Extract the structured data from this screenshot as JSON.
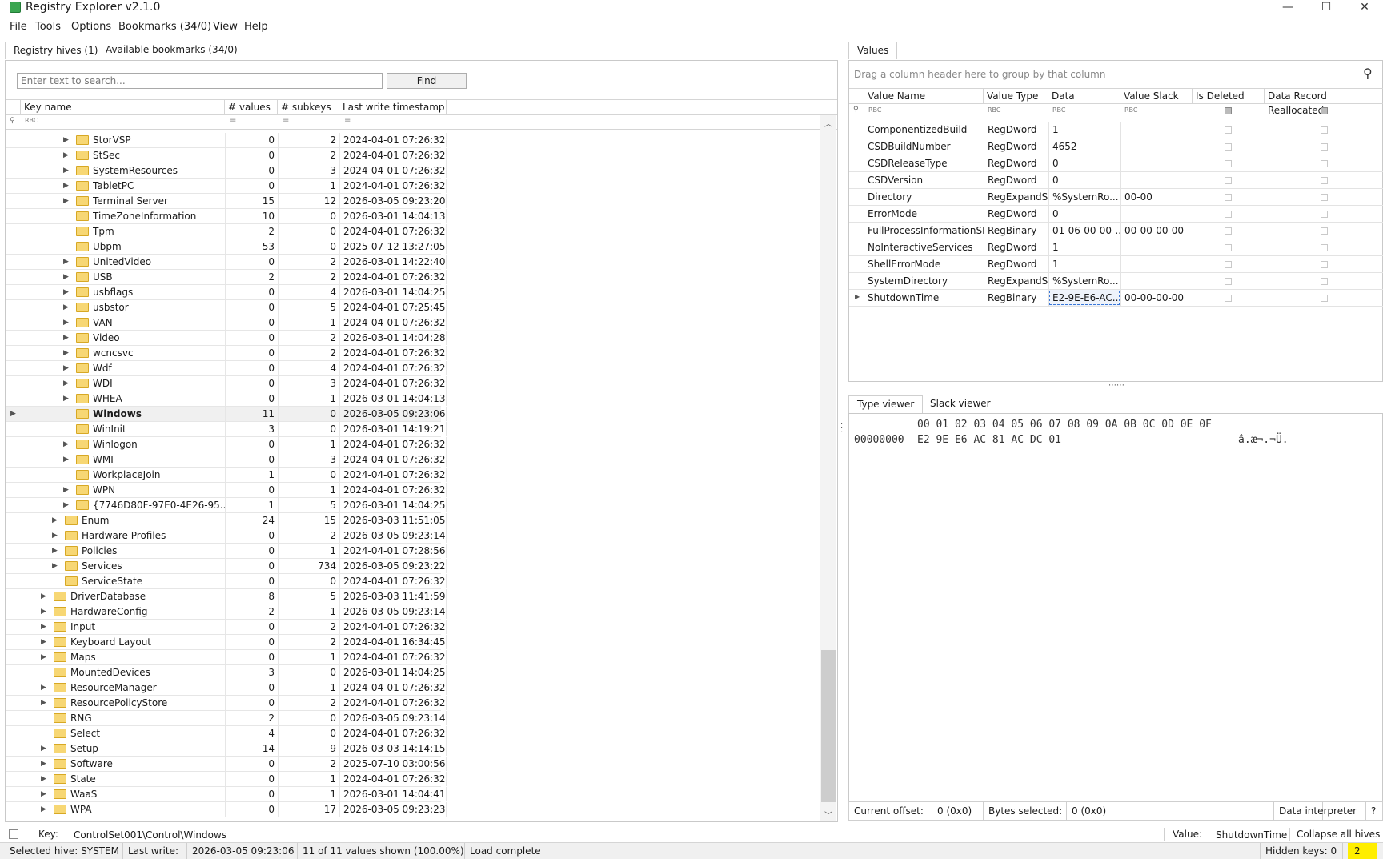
{
  "window": {
    "title": "Registry Explorer v2.1.0",
    "minimize": "—",
    "maximize": "☐",
    "close": "✕"
  },
  "menu": [
    "File",
    "Tools",
    "Options",
    "Bookmarks (34/0)",
    "View",
    "Help"
  ],
  "left_tabs": [
    "Registry hives (1)",
    "Available bookmarks (34/0)"
  ],
  "search": {
    "placeholder": "Enter text to search...",
    "find_label": "Find"
  },
  "tree_headers": [
    "Key name",
    "# values",
    "# subkeys",
    "Last write timestamp"
  ],
  "tree_filter": {
    "text_icon": "RBC",
    "eq": "="
  },
  "tree_rows": [
    {
      "name": "StorVSP",
      "indent": 4,
      "exp": true,
      "values": "0",
      "subkeys": "2",
      "ts": "2024-04-01 07:26:32"
    },
    {
      "name": "StSec",
      "indent": 4,
      "exp": true,
      "values": "0",
      "subkeys": "2",
      "ts": "2024-04-01 07:26:32"
    },
    {
      "name": "SystemResources",
      "indent": 4,
      "exp": true,
      "values": "0",
      "subkeys": "3",
      "ts": "2024-04-01 07:26:32"
    },
    {
      "name": "TabletPC",
      "indent": 4,
      "exp": true,
      "values": "0",
      "subkeys": "1",
      "ts": "2024-04-01 07:26:32"
    },
    {
      "name": "Terminal Server",
      "indent": 4,
      "exp": true,
      "values": "15",
      "subkeys": "12",
      "ts": "2026-03-05 09:23:20"
    },
    {
      "name": "TimeZoneInformation",
      "indent": 4,
      "exp": false,
      "values": "10",
      "subkeys": "0",
      "ts": "2026-03-01 14:04:13"
    },
    {
      "name": "Tpm",
      "indent": 4,
      "exp": false,
      "values": "2",
      "subkeys": "0",
      "ts": "2024-04-01 07:26:32"
    },
    {
      "name": "Ubpm",
      "indent": 4,
      "exp": false,
      "values": "53",
      "subkeys": "0",
      "ts": "2025-07-12 13:27:05"
    },
    {
      "name": "UnitedVideo",
      "indent": 4,
      "exp": true,
      "values": "0",
      "subkeys": "2",
      "ts": "2026-03-01 14:22:40"
    },
    {
      "name": "USB",
      "indent": 4,
      "exp": true,
      "values": "2",
      "subkeys": "2",
      "ts": "2024-04-01 07:26:32"
    },
    {
      "name": "usbflags",
      "indent": 4,
      "exp": true,
      "values": "0",
      "subkeys": "4",
      "ts": "2026-03-01 14:04:25"
    },
    {
      "name": "usbstor",
      "indent": 4,
      "exp": true,
      "values": "0",
      "subkeys": "5",
      "ts": "2024-04-01 07:25:45"
    },
    {
      "name": "VAN",
      "indent": 4,
      "exp": true,
      "values": "0",
      "subkeys": "1",
      "ts": "2024-04-01 07:26:32"
    },
    {
      "name": "Video",
      "indent": 4,
      "exp": true,
      "values": "0",
      "subkeys": "2",
      "ts": "2026-03-01 14:04:28"
    },
    {
      "name": "wcncsvc",
      "indent": 4,
      "exp": true,
      "values": "0",
      "subkeys": "2",
      "ts": "2024-04-01 07:26:32"
    },
    {
      "name": "Wdf",
      "indent": 4,
      "exp": true,
      "values": "0",
      "subkeys": "4",
      "ts": "2024-04-01 07:26:32"
    },
    {
      "name": "WDI",
      "indent": 4,
      "exp": true,
      "values": "0",
      "subkeys": "3",
      "ts": "2024-04-01 07:26:32"
    },
    {
      "name": "WHEA",
      "indent": 4,
      "exp": true,
      "values": "0",
      "subkeys": "1",
      "ts": "2026-03-01 14:04:13"
    },
    {
      "name": "Windows",
      "indent": 4,
      "exp": false,
      "values": "11",
      "subkeys": "0",
      "ts": "2026-03-05 09:23:06",
      "selected": true
    },
    {
      "name": "WinInit",
      "indent": 4,
      "exp": false,
      "values": "3",
      "subkeys": "0",
      "ts": "2026-03-01 14:19:21"
    },
    {
      "name": "Winlogon",
      "indent": 4,
      "exp": true,
      "values": "0",
      "subkeys": "1",
      "ts": "2024-04-01 07:26:32"
    },
    {
      "name": "WMI",
      "indent": 4,
      "exp": true,
      "values": "0",
      "subkeys": "3",
      "ts": "2024-04-01 07:26:32"
    },
    {
      "name": "WorkplaceJoin",
      "indent": 4,
      "exp": false,
      "values": "1",
      "subkeys": "0",
      "ts": "2024-04-01 07:26:32"
    },
    {
      "name": "WPN",
      "indent": 4,
      "exp": true,
      "values": "0",
      "subkeys": "1",
      "ts": "2024-04-01 07:26:32"
    },
    {
      "name": "{7746D80F-97E0-4E26-95...",
      "indent": 4,
      "exp": true,
      "values": "1",
      "subkeys": "5",
      "ts": "2026-03-01 14:04:25"
    },
    {
      "name": "Enum",
      "indent": 3,
      "exp": true,
      "values": "24",
      "subkeys": "15",
      "ts": "2026-03-03 11:51:05"
    },
    {
      "name": "Hardware Profiles",
      "indent": 3,
      "exp": true,
      "values": "0",
      "subkeys": "2",
      "ts": "2026-03-05 09:23:14"
    },
    {
      "name": "Policies",
      "indent": 3,
      "exp": true,
      "values": "0",
      "subkeys": "1",
      "ts": "2024-04-01 07:28:56"
    },
    {
      "name": "Services",
      "indent": 3,
      "exp": true,
      "values": "0",
      "subkeys": "734",
      "ts": "2026-03-05 09:23:22"
    },
    {
      "name": "ServiceState",
      "indent": 3,
      "exp": false,
      "values": "0",
      "subkeys": "0",
      "ts": "2024-04-01 07:26:32"
    },
    {
      "name": "DriverDatabase",
      "indent": 2,
      "exp": true,
      "values": "8",
      "subkeys": "5",
      "ts": "2026-03-03 11:41:59"
    },
    {
      "name": "HardwareConfig",
      "indent": 2,
      "exp": true,
      "values": "2",
      "subkeys": "1",
      "ts": "2026-03-05 09:23:14"
    },
    {
      "name": "Input",
      "indent": 2,
      "exp": true,
      "values": "0",
      "subkeys": "2",
      "ts": "2024-04-01 07:26:32"
    },
    {
      "name": "Keyboard Layout",
      "indent": 2,
      "exp": true,
      "values": "0",
      "subkeys": "2",
      "ts": "2024-04-01 16:34:45"
    },
    {
      "name": "Maps",
      "indent": 2,
      "exp": true,
      "values": "0",
      "subkeys": "1",
      "ts": "2024-04-01 07:26:32"
    },
    {
      "name": "MountedDevices",
      "indent": 2,
      "exp": false,
      "values": "3",
      "subkeys": "0",
      "ts": "2026-03-01 14:04:25"
    },
    {
      "name": "ResourceManager",
      "indent": 2,
      "exp": true,
      "values": "0",
      "subkeys": "1",
      "ts": "2024-04-01 07:26:32"
    },
    {
      "name": "ResourcePolicyStore",
      "indent": 2,
      "exp": true,
      "values": "0",
      "subkeys": "2",
      "ts": "2024-04-01 07:26:32"
    },
    {
      "name": "RNG",
      "indent": 2,
      "exp": false,
      "values": "2",
      "subkeys": "0",
      "ts": "2026-03-05 09:23:14"
    },
    {
      "name": "Select",
      "indent": 2,
      "exp": false,
      "values": "4",
      "subkeys": "0",
      "ts": "2024-04-01 07:26:32"
    },
    {
      "name": "Setup",
      "indent": 2,
      "exp": true,
      "values": "14",
      "subkeys": "9",
      "ts": "2026-03-03 14:14:15"
    },
    {
      "name": "Software",
      "indent": 2,
      "exp": true,
      "values": "0",
      "subkeys": "2",
      "ts": "2025-07-10 03:00:56"
    },
    {
      "name": "State",
      "indent": 2,
      "exp": true,
      "values": "0",
      "subkeys": "1",
      "ts": "2024-04-01 07:26:32"
    },
    {
      "name": "WaaS",
      "indent": 2,
      "exp": true,
      "values": "0",
      "subkeys": "1",
      "ts": "2026-03-01 14:04:41"
    },
    {
      "name": "WPA",
      "indent": 2,
      "exp": true,
      "values": "0",
      "subkeys": "17",
      "ts": "2026-03-05 09:23:23"
    }
  ],
  "values_tab": "Values",
  "group_hint": "Drag a column header here to group by that column",
  "values_headers": [
    "Value Name",
    "Value Type",
    "Data",
    "Value Slack",
    "Is Deleted",
    "Data Record Reallocated"
  ],
  "values_rows": [
    {
      "name": "ComponentizedBuild",
      "type": "RegDword",
      "data": "1",
      "slack": ""
    },
    {
      "name": "CSDBuildNumber",
      "type": "RegDword",
      "data": "4652",
      "slack": ""
    },
    {
      "name": "CSDReleaseType",
      "type": "RegDword",
      "data": "0",
      "slack": ""
    },
    {
      "name": "CSDVersion",
      "type": "RegDword",
      "data": "0",
      "slack": ""
    },
    {
      "name": "Directory",
      "type": "RegExpandSz",
      "data": "%SystemRo...",
      "slack": "00-00"
    },
    {
      "name": "ErrorMode",
      "type": "RegDword",
      "data": "0",
      "slack": ""
    },
    {
      "name": "FullProcessInformationSID",
      "type": "RegBinary",
      "data": "01-06-00-00-...",
      "slack": "00-00-00-00"
    },
    {
      "name": "NoInteractiveServices",
      "type": "RegDword",
      "data": "1",
      "slack": ""
    },
    {
      "name": "ShellErrorMode",
      "type": "RegDword",
      "data": "1",
      "slack": ""
    },
    {
      "name": "SystemDirectory",
      "type": "RegExpandSz",
      "data": "%SystemRo...",
      "slack": ""
    },
    {
      "name": "ShutdownTime",
      "type": "RegBinary",
      "data": "E2-9E-E6-AC...",
      "slack": "00-00-00-00",
      "selected": true
    }
  ],
  "viewer_tabs": [
    "Type viewer",
    "Slack viewer"
  ],
  "hex": {
    "header": "00 01 02 03 04 05 06 07 08 09 0A 0B 0C 0D 0E 0F",
    "offset": "00000000",
    "bytes": "E2 9E E6 AC 81 AC DC 01",
    "ascii": "â.æ¬.¬Ü."
  },
  "viewer_status": {
    "offset_label": "Current offset:",
    "offset_value": "0 (0x0)",
    "bytes_label": "Bytes selected:",
    "bytes_value": "0 (0x0)",
    "interpreter": "Data interpreter",
    "help": "?"
  },
  "keybar": {
    "key_label": "Key:",
    "key_value": "ControlSet001\\Control\\Windows",
    "value_label": "Value:",
    "value_value": "ShutdownTime",
    "collapse": "Collapse all hives"
  },
  "statusbar": {
    "hive": "Selected hive: SYSTEM",
    "lastwrite_label": "Last write:",
    "lastwrite_value": "2026-03-05 09:23:06",
    "shown": "11 of 11 values shown (100.00%)",
    "load": "Load complete",
    "hidden": "Hidden keys: 0",
    "badge": "2"
  },
  "colors": {
    "selection_border": "#3b78d8",
    "badge_bg": "#ffee00"
  }
}
